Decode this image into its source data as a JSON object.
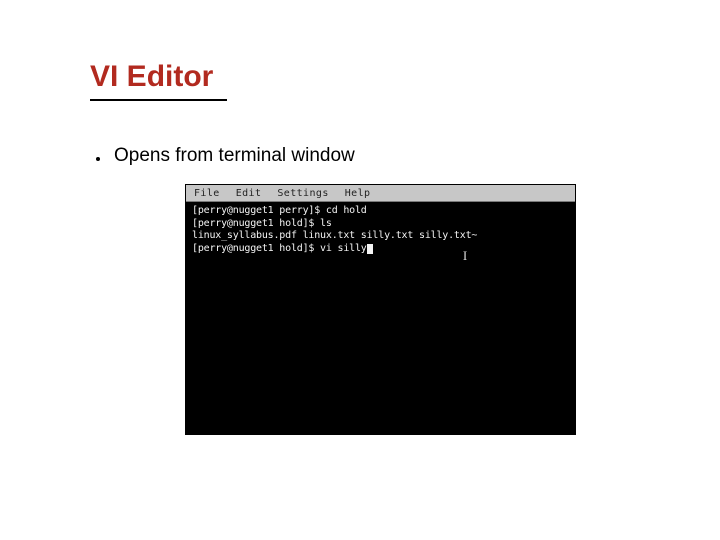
{
  "title": "VI Editor",
  "bullet": "Opens from terminal window",
  "terminal": {
    "menu": {
      "file": "File",
      "edit": "Edit",
      "settings": "Settings",
      "help": "Help"
    },
    "lines": [
      "[perry@nugget1 perry]$ cd hold",
      "[perry@nugget1 hold]$ ls",
      "linux_syllabus.pdf  linux.txt  silly.txt  silly.txt~",
      "[perry@nugget1 hold]$ vi silly"
    ],
    "ibeam": "I"
  }
}
